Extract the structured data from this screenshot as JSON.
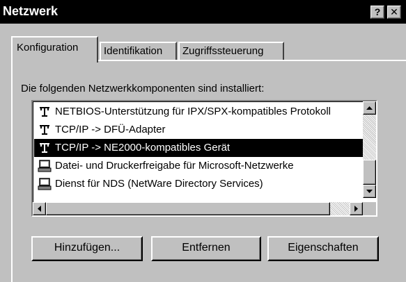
{
  "window": {
    "title": "Netzwerk",
    "help_button": "?",
    "close_button": "✕"
  },
  "tabs": [
    {
      "label": "Konfiguration",
      "active": true
    },
    {
      "label": "Identifikation",
      "active": false
    },
    {
      "label": "Zugriffssteuerung",
      "active": false
    }
  ],
  "components": {
    "label": "Die folgenden Netzwerkkomponenten sind installiert:",
    "items": [
      {
        "label": "NETBIOS-Unterstützung für IPX/SPX-kompatibles Protokoll",
        "icon": "network-protocol-icon",
        "selected": false
      },
      {
        "label": "TCP/IP -> DFÜ-Adapter",
        "icon": "network-protocol-icon",
        "selected": false
      },
      {
        "label": "TCP/IP -> NE2000-kompatibles Gerät",
        "icon": "network-protocol-icon",
        "selected": true
      },
      {
        "label": "Datei- und Druckerfreigabe für Microsoft-Netzwerke",
        "icon": "network-service-icon",
        "selected": false
      },
      {
        "label": "Dienst für NDS (NetWare Directory Services)",
        "icon": "network-service-icon",
        "selected": false
      }
    ]
  },
  "buttons": {
    "add": "Hinzufügen...",
    "remove": "Entfernen",
    "properties": "Eigenschaften"
  }
}
